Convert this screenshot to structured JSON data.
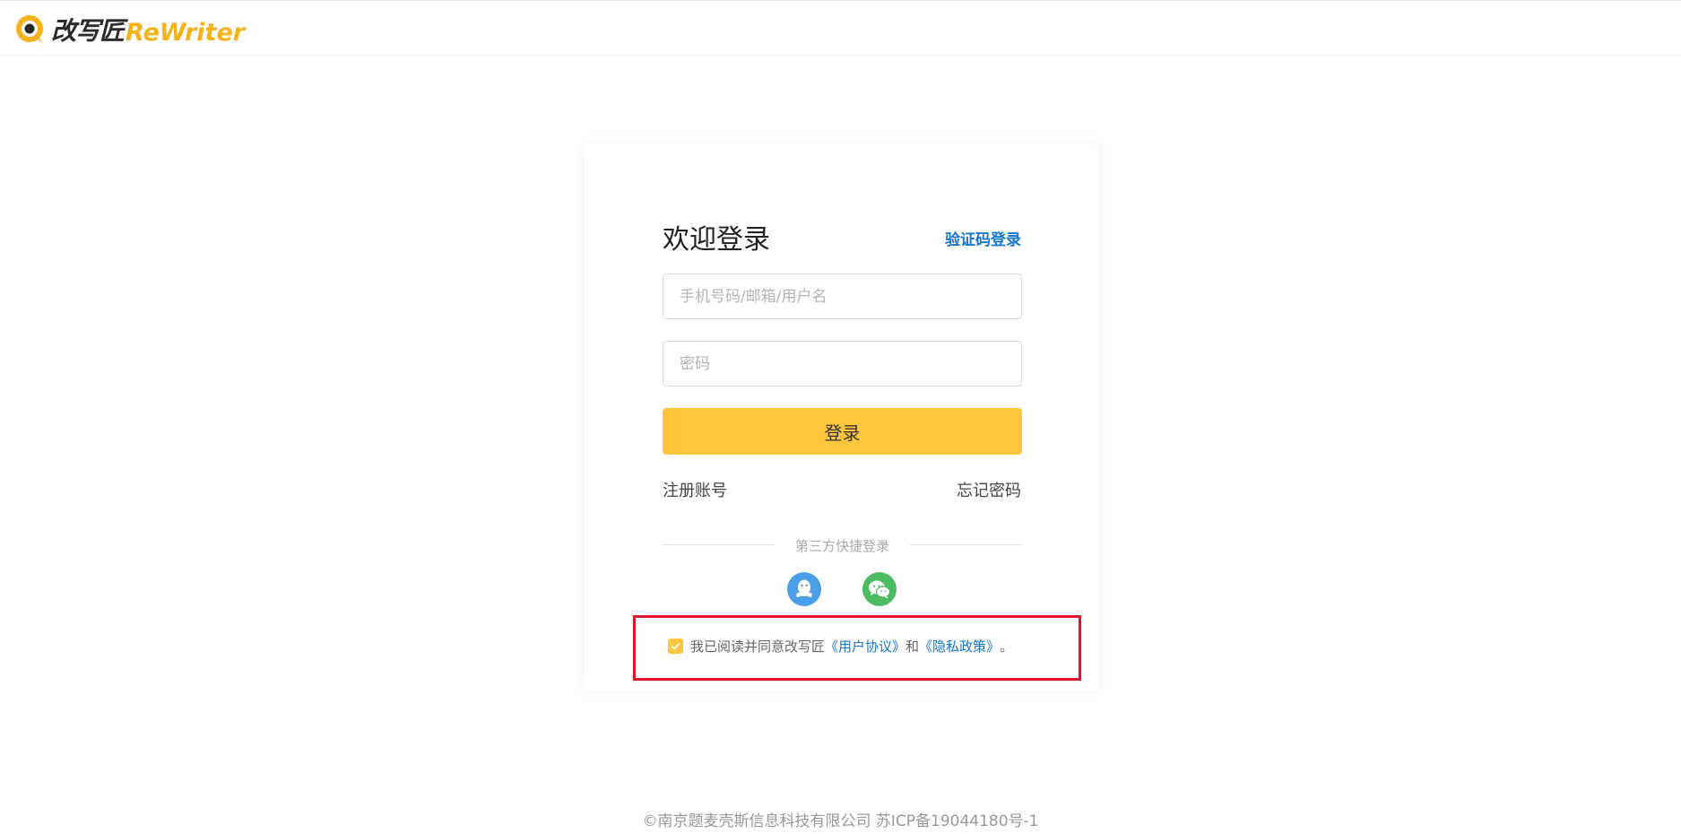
{
  "header": {
    "logo_cn": "改写匠",
    "logo_en": "ReWriter"
  },
  "login": {
    "title": "欢迎登录",
    "sms_login": "验证码登录",
    "username_placeholder": "手机号码/邮箱/用户名",
    "password_placeholder": "密码",
    "login_button": "登录",
    "register": "注册账号",
    "forgot": "忘记密码",
    "third_party": "第三方快捷登录"
  },
  "agreement": {
    "prefix": "我已阅读并同意改写匠",
    "user_agreement": "《用户协议》",
    "and": "和",
    "privacy_policy": "《隐私政策》",
    "suffix": "。",
    "checked": true
  },
  "footer": {
    "text": "©南京题麦壳斯信息科技有限公司 苏ICP备19044180号-1"
  },
  "colors": {
    "accent": "#ffc53d",
    "link": "#1677d2",
    "highlight_border": "#e0162b",
    "qq": "#4a9fe8",
    "wechat": "#4cbb62"
  }
}
